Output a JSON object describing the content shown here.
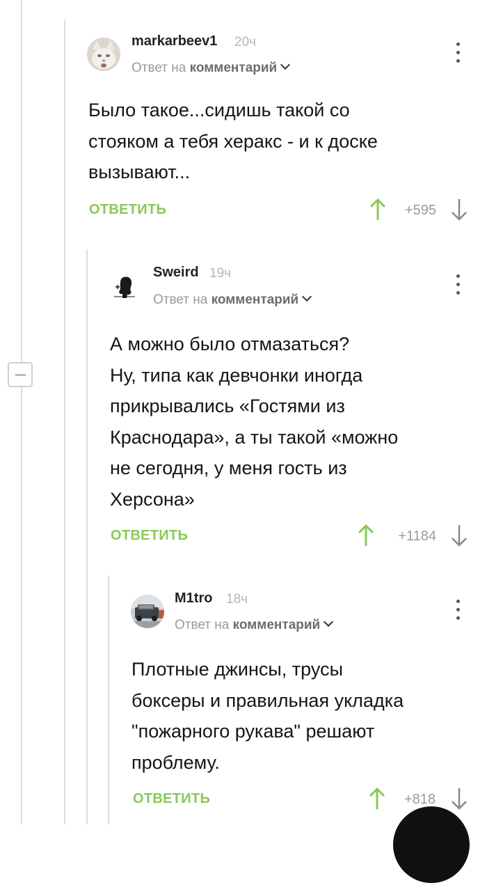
{
  "comments": [
    {
      "username": "markarbeev1",
      "time": "20ч",
      "reply_prefix": "Ответ на",
      "reply_target": "комментарий",
      "body": [
        "Было такое...сидишь такой со",
        "стояком а тебя херакс - и к доске",
        "вызывают..."
      ],
      "reply_label": "ОТВЕТИТЬ",
      "rating": "+595",
      "avatar_icon": "cat-avatar-icon"
    },
    {
      "username": "Sweird",
      "time": "19ч",
      "reply_prefix": "Ответ на",
      "reply_target": "комментарий",
      "body": [
        "А можно было отмазаться?",
        "Ну, типа как девчонки иногда",
        "прикрывались «Гостями из",
        "Краснодара», а ты такой «можно",
        "не сегодня, у меня гость из",
        "Херсона»"
      ],
      "reply_label": "ОТВЕТИТЬ",
      "rating": "+1184",
      "avatar_icon": "silhouette-avatar-icon"
    },
    {
      "username": "M1tro",
      "time": "18ч",
      "reply_prefix": "Ответ на",
      "reply_target": "комментарий",
      "body": [
        "Плотные джинсы, трусы",
        "боксеры и правильная укладка",
        "\"пожарного рукава\" решают",
        "проблему."
      ],
      "reply_label": "ОТВЕТИТЬ",
      "rating": "+818",
      "avatar_icon": "car-avatar-icon"
    }
  ],
  "colors": {
    "accent_green": "#8ac858",
    "thread_line": "#dedede",
    "muted_text": "#9a9a9a"
  }
}
